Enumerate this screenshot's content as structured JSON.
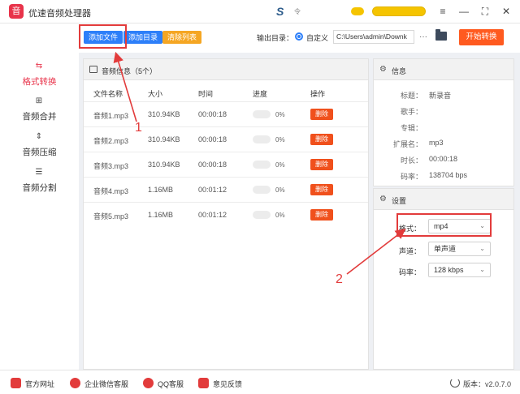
{
  "app": {
    "title": "优速音频处理器",
    "logo_text": "音",
    "brand_mark": "S",
    "brand_small": "令"
  },
  "window_controls": {
    "menu": "≡",
    "minimize": "—",
    "maximize": "⛶",
    "close": "✕"
  },
  "toolbar": {
    "add_file": "添加文件",
    "add_folder": "添加目录",
    "clear_list": "清除列表",
    "output_label": "输出目录：",
    "radio_label": "自定义",
    "output_path": "C:\\Users\\admin\\Downk",
    "more": "···",
    "start": "开始转换"
  },
  "sidebar": {
    "items": [
      {
        "label": "格式转换",
        "icon": "convert-icon",
        "glyph": "⇆",
        "active": true
      },
      {
        "label": "音频合并",
        "icon": "merge-icon",
        "glyph": "⊞",
        "active": false
      },
      {
        "label": "音频压缩",
        "icon": "compress-icon",
        "glyph": "⇕",
        "active": false
      },
      {
        "label": "音频分割",
        "icon": "split-icon",
        "glyph": "☰",
        "active": false
      }
    ]
  },
  "files": {
    "title": "音频信息（5个）",
    "columns": [
      "文件名称",
      "大小",
      "时间",
      "进度",
      "操作"
    ],
    "delete_label": "删除",
    "rows": [
      {
        "name": "音频1.mp3",
        "size": "310.94KB",
        "time": "00:00:18",
        "progress": "0%",
        "progress_value": 0
      },
      {
        "name": "音频2.mp3",
        "size": "310.94KB",
        "time": "00:00:18",
        "progress": "0%",
        "progress_value": 0
      },
      {
        "name": "音频3.mp3",
        "size": "310.94KB",
        "time": "00:00:18",
        "progress": "0%",
        "progress_value": 0
      },
      {
        "name": "音频4.mp3",
        "size": "1.16MB",
        "time": "00:01:12",
        "progress": "0%",
        "progress_value": 0
      },
      {
        "name": "音频5.mp3",
        "size": "1.16MB",
        "time": "00:01:12",
        "progress": "0%",
        "progress_value": 0
      }
    ]
  },
  "info": {
    "title": "信息",
    "fields": [
      {
        "key": "标题：",
        "value": "新录音"
      },
      {
        "key": "歌手：",
        "value": ""
      },
      {
        "key": "专辑：",
        "value": ""
      },
      {
        "key": "扩展名：",
        "value": "mp3"
      },
      {
        "key": "时长：",
        "value": "00:00:18"
      },
      {
        "key": "码率：",
        "value": "138704 bps"
      }
    ]
  },
  "settings": {
    "title": "设置",
    "format_label": "格式：",
    "format_value": "mp4",
    "channel_label": "声道：",
    "channel_value": "单声道",
    "bitrate_label": "码率：",
    "bitrate_value": "128 kbps"
  },
  "annotations": {
    "one": "1",
    "two": "2"
  },
  "footer": {
    "website": "官方网址",
    "wechat": "企业微信客服",
    "qq": "QQ客服",
    "feedback": "意见反馈",
    "version": "版本：v2.0.7.0"
  }
}
